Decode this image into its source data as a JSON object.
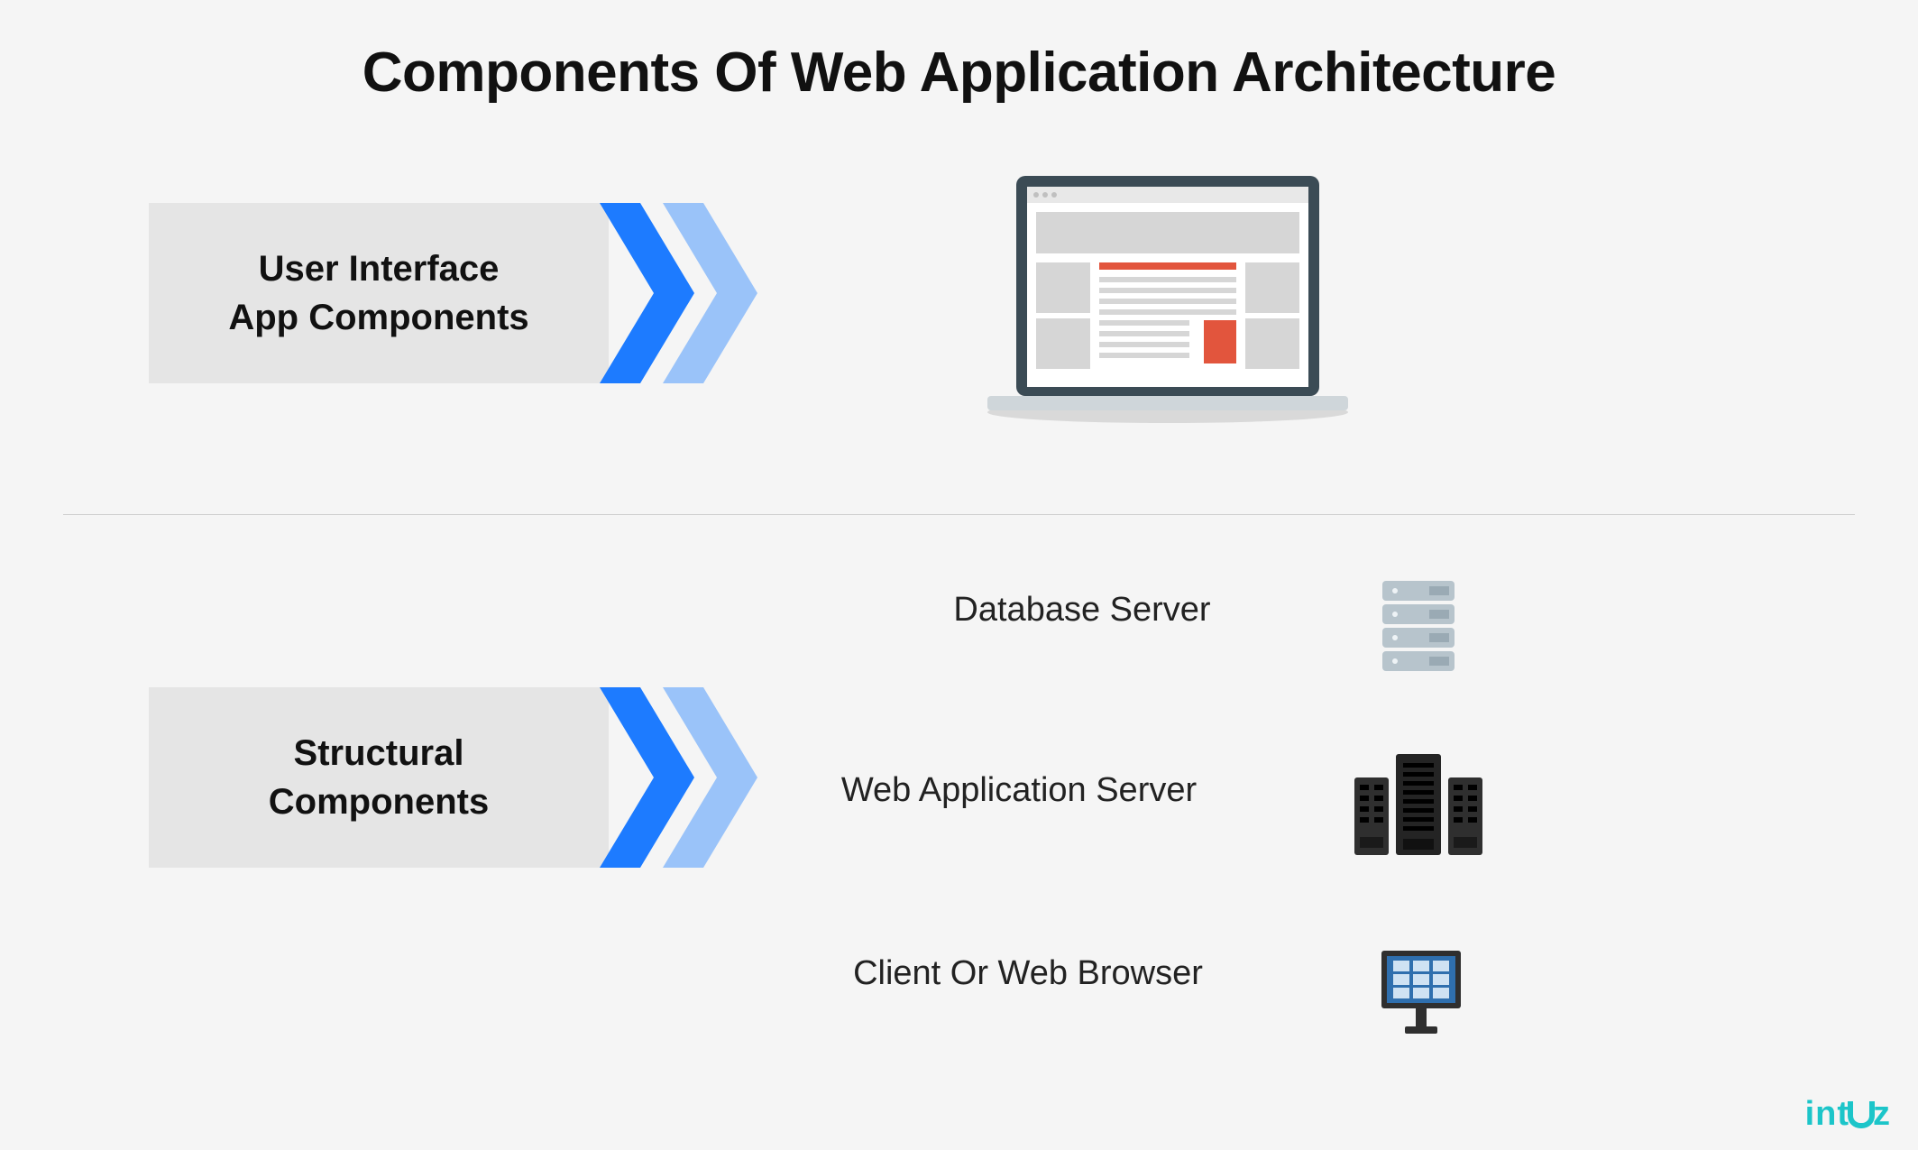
{
  "title": "Components Of Web Application Architecture",
  "category1": {
    "line1": "User Interface",
    "line2": "App Components"
  },
  "category2": {
    "line1": "Structural",
    "line2": "Components"
  },
  "items": {
    "database": "Database Server",
    "app_server": "Web Application Server",
    "client": "Client Or Web Browser"
  },
  "brand": "intuz",
  "icons": {
    "laptop": "laptop-web-icon",
    "database": "database-server-icon",
    "app_server": "server-cluster-icon",
    "client": "monitor-grid-icon",
    "chevron": "double-chevron-right-icon"
  },
  "colors": {
    "chevron_primary": "#1d7bff",
    "chevron_secondary": "#9ac3f9",
    "box_bg": "#e5e5e5",
    "brand": "#1cc5c9",
    "laptop_accent": "#e2553d",
    "laptop_frame": "#3b4b55"
  }
}
